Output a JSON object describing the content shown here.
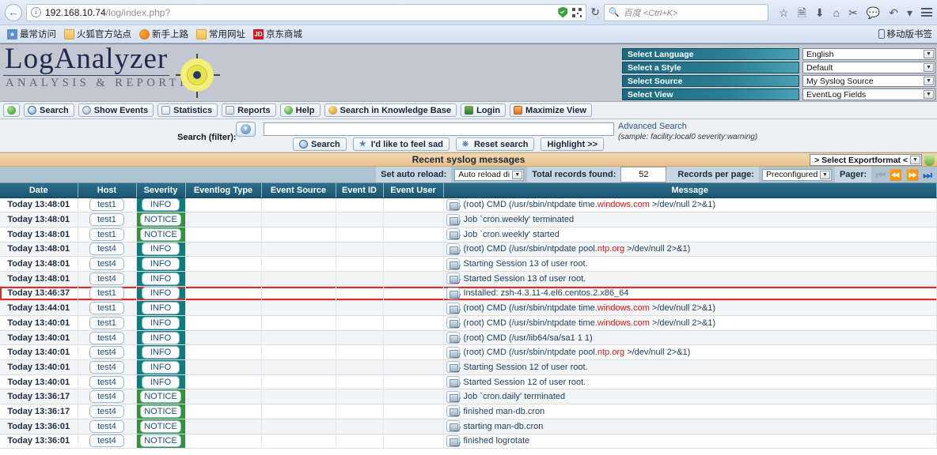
{
  "browser": {
    "back_icon": "back-arrow-icon",
    "url": "192.168.10.74",
    "url_path": "/log/index.php?",
    "search_placeholder": "百度 <Ctrl+K>",
    "bookmarks": [
      {
        "label": "最常访问",
        "icon": "most-visited-icon"
      },
      {
        "label": "火狐官方站点",
        "icon": "folder-icon"
      },
      {
        "label": "新手上路",
        "icon": "firefox-icon"
      },
      {
        "label": "常用网址",
        "icon": "folder-icon"
      },
      {
        "label": "京东商城",
        "icon": "jd-icon"
      }
    ],
    "bookmark_overflow": "移动版书签"
  },
  "header": {
    "logo_main": "LogAnalyzer",
    "logo_sub": "ANALYSIS & REPORTING",
    "selects": [
      {
        "label": "Select Language",
        "value": "English"
      },
      {
        "label": "Select a Style",
        "value": "Default"
      },
      {
        "label": "Select Source",
        "value": "My Syslog Source"
      },
      {
        "label": "Select View",
        "value": "EventLog Fields"
      }
    ]
  },
  "toolbar": {
    "buttons": [
      {
        "label": "",
        "icon": "green-orb-icon"
      },
      {
        "label": "Search",
        "icon": "magnifier-icon"
      },
      {
        "label": "Show Events",
        "icon": "clock-icon"
      },
      {
        "label": "Statistics",
        "icon": "chart-icon"
      },
      {
        "label": "Reports",
        "icon": "report-icon"
      },
      {
        "label": "Help",
        "icon": "help-icon"
      },
      {
        "label": "Search in Knowledge Base",
        "icon": "knowledge-base-icon"
      },
      {
        "label": "Login",
        "icon": "login-icon"
      },
      {
        "label": "Maximize View",
        "icon": "maximize-icon"
      }
    ]
  },
  "search": {
    "label": "Search (filter):",
    "value": "",
    "advanced_link": "Advanced Search",
    "sample": "(sample: facility:local0 severity:warning)",
    "buttons": [
      {
        "label": "Search",
        "icon": "magnifier-icon"
      },
      {
        "label": "I'd like to feel sad",
        "icon": "star-icon"
      },
      {
        "label": "Reset search",
        "icon": "reset-icon"
      },
      {
        "label": "Highlight >>",
        "icon": ""
      }
    ]
  },
  "section": {
    "title": "Recent syslog messages",
    "export_label": "> Select Exportformat <"
  },
  "controls": {
    "auto_reload_label": "Set auto reload:",
    "auto_reload_value": "Auto reload di",
    "total_records_label": "Total records found:",
    "total_records_value": "52",
    "records_per_page_label": "Records per page:",
    "records_per_page_value": "Preconfigured",
    "pager_label": "Pager:",
    "pager_buttons": [
      "first-page-icon",
      "prev-page-icon",
      "next-page-icon",
      "last-page-icon"
    ]
  },
  "table": {
    "columns": [
      "Date",
      "Host",
      "Severity",
      "Eventlog Type",
      "Event Source",
      "Event ID",
      "Event User",
      "Message"
    ],
    "rows": [
      {
        "date": "Today 13:48:01",
        "host": "test1",
        "severity": "INFO",
        "sev_color": "#0a7d7d",
        "eventlog_type": "",
        "event_source": "",
        "event_id": "",
        "event_user": "",
        "message_pre": "(root) CMD (/usr/sbin/ntpdate time.",
        "message_hl": "windows.com",
        "message_post": " >/dev/null 2>&1)",
        "highlighted": false
      },
      {
        "date": "Today 13:48:01",
        "host": "test1",
        "severity": "NOTICE",
        "sev_color": "#2e9638",
        "eventlog_type": "",
        "event_source": "",
        "event_id": "",
        "event_user": "",
        "message_pre": "Job `cron.weekly' terminated",
        "message_hl": "",
        "message_post": "",
        "highlighted": false
      },
      {
        "date": "Today 13:48:01",
        "host": "test1",
        "severity": "NOTICE",
        "sev_color": "#2e9638",
        "eventlog_type": "",
        "event_source": "",
        "event_id": "",
        "event_user": "",
        "message_pre": "Job `cron.weekly' started",
        "message_hl": "",
        "message_post": "",
        "highlighted": false
      },
      {
        "date": "Today 13:48:01",
        "host": "test4",
        "severity": "INFO",
        "sev_color": "#0a7d7d",
        "eventlog_type": "",
        "event_source": "",
        "event_id": "",
        "event_user": "",
        "message_pre": "(root) CMD (/usr/sbin/ntpdate pool.",
        "message_hl": "ntp.org",
        "message_post": " >/dev/null 2>&1)",
        "highlighted": false
      },
      {
        "date": "Today 13:48:01",
        "host": "test4",
        "severity": "INFO",
        "sev_color": "#0a7d7d",
        "eventlog_type": "",
        "event_source": "",
        "event_id": "",
        "event_user": "",
        "message_pre": "Starting Session 13 of user root.",
        "message_hl": "",
        "message_post": "",
        "highlighted": false
      },
      {
        "date": "Today 13:48:01",
        "host": "test4",
        "severity": "INFO",
        "sev_color": "#0a7d7d",
        "eventlog_type": "",
        "event_source": "",
        "event_id": "",
        "event_user": "",
        "message_pre": "Started Session 13 of user root.",
        "message_hl": "",
        "message_post": "",
        "highlighted": false
      },
      {
        "date": "Today 13:46:37",
        "host": "test1",
        "severity": "INFO",
        "sev_color": "#0a7d7d",
        "eventlog_type": "",
        "event_source": "",
        "event_id": "",
        "event_user": "",
        "message_pre": "Installed: zsh-4.3.11-4.el6.centos.2.x86_64",
        "message_hl": "",
        "message_post": "",
        "highlighted": true
      },
      {
        "date": "Today 13:44:01",
        "host": "test1",
        "severity": "INFO",
        "sev_color": "#0a7d7d",
        "eventlog_type": "",
        "event_source": "",
        "event_id": "",
        "event_user": "",
        "message_pre": "(root) CMD (/usr/sbin/ntpdate time.",
        "message_hl": "windows.com",
        "message_post": " >/dev/null 2>&1)",
        "highlighted": false
      },
      {
        "date": "Today 13:40:01",
        "host": "test1",
        "severity": "INFO",
        "sev_color": "#0a7d7d",
        "eventlog_type": "",
        "event_source": "",
        "event_id": "",
        "event_user": "",
        "message_pre": "(root) CMD (/usr/sbin/ntpdate time.",
        "message_hl": "windows.com",
        "message_post": " >/dev/null 2>&1)",
        "highlighted": false
      },
      {
        "date": "Today 13:40:01",
        "host": "test4",
        "severity": "INFO",
        "sev_color": "#0a7d7d",
        "eventlog_type": "",
        "event_source": "",
        "event_id": "",
        "event_user": "",
        "message_pre": "(root) CMD (/usr/lib64/sa/sa1 1 1)",
        "message_hl": "",
        "message_post": "",
        "highlighted": false
      },
      {
        "date": "Today 13:40:01",
        "host": "test4",
        "severity": "INFO",
        "sev_color": "#0a7d7d",
        "eventlog_type": "",
        "event_source": "",
        "event_id": "",
        "event_user": "",
        "message_pre": "(root) CMD (/usr/sbin/ntpdate pool.",
        "message_hl": "ntp.org",
        "message_post": " >/dev/null 2>&1)",
        "highlighted": false
      },
      {
        "date": "Today 13:40:01",
        "host": "test4",
        "severity": "INFO",
        "sev_color": "#0a7d7d",
        "eventlog_type": "",
        "event_source": "",
        "event_id": "",
        "event_user": "",
        "message_pre": "Starting Session 12 of user root.",
        "message_hl": "",
        "message_post": "",
        "highlighted": false
      },
      {
        "date": "Today 13:40:01",
        "host": "test4",
        "severity": "INFO",
        "sev_color": "#0a7d7d",
        "eventlog_type": "",
        "event_source": "",
        "event_id": "",
        "event_user": "",
        "message_pre": "Started Session 12 of user root.",
        "message_hl": "",
        "message_post": "",
        "highlighted": false
      },
      {
        "date": "Today 13:36:17",
        "host": "test4",
        "severity": "NOTICE",
        "sev_color": "#2e9638",
        "eventlog_type": "",
        "event_source": "",
        "event_id": "",
        "event_user": "",
        "message_pre": "Job `cron.daily' terminated",
        "message_hl": "",
        "message_post": "",
        "highlighted": false
      },
      {
        "date": "Today 13:36:17",
        "host": "test4",
        "severity": "NOTICE",
        "sev_color": "#2e9638",
        "eventlog_type": "",
        "event_source": "",
        "event_id": "",
        "event_user": "",
        "message_pre": "finished man-db.cron",
        "message_hl": "",
        "message_post": "",
        "highlighted": false
      },
      {
        "date": "Today 13:36:01",
        "host": "test4",
        "severity": "NOTICE",
        "sev_color": "#2e9638",
        "eventlog_type": "",
        "event_source": "",
        "event_id": "",
        "event_user": "",
        "message_pre": "starting man-db.cron",
        "message_hl": "",
        "message_post": "",
        "highlighted": false
      },
      {
        "date": "Today 13:36:01",
        "host": "test4",
        "severity": "NOTICE",
        "sev_color": "#2e9638",
        "eventlog_type": "",
        "event_source": "",
        "event_id": "",
        "event_user": "",
        "message_pre": "finished logrotate",
        "message_hl": "",
        "message_post": "",
        "highlighted": false
      }
    ]
  },
  "colors": {
    "accent_teal": "#1b5671",
    "severity_info": "#0a7d7d",
    "severity_notice": "#2e9638",
    "highlight_border": "#e02b2b",
    "section_bg": "#e7c28b"
  }
}
